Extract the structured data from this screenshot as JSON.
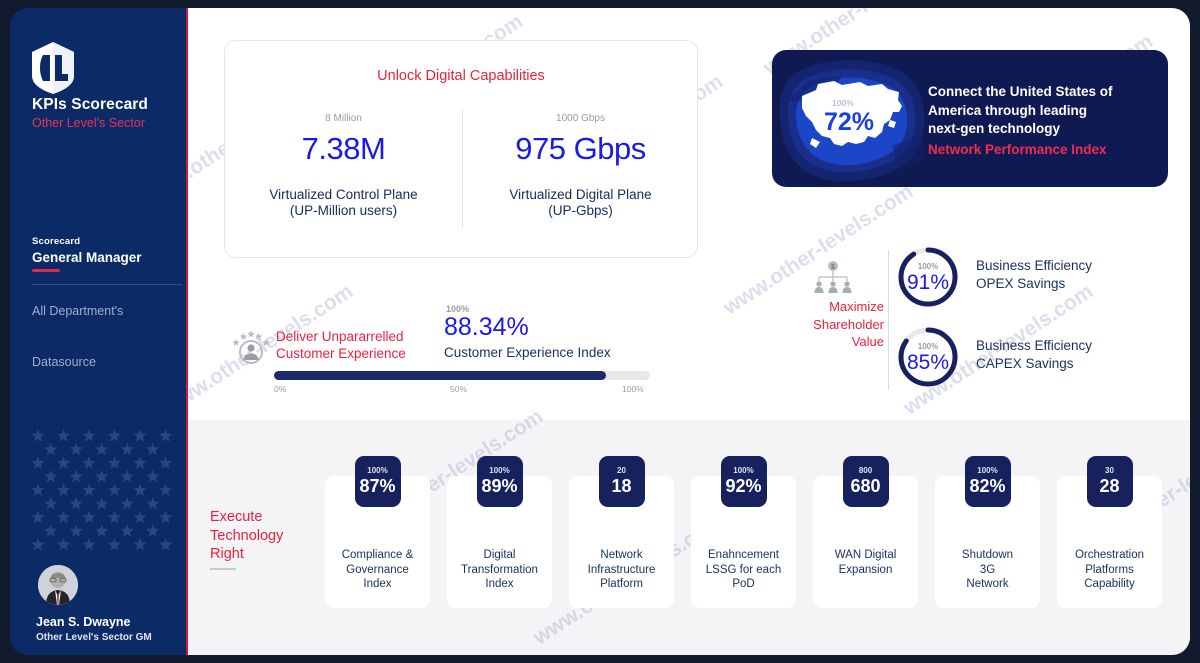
{
  "brand": {
    "logo_icon": "ol-shield-logo",
    "title": "KPIs Scorecard",
    "subtitle": "Other Level's Sector"
  },
  "sidebar": {
    "active": {
      "eyebrow": "Scorecard",
      "label": "General Manager"
    },
    "items": [
      {
        "label": "All Department's"
      },
      {
        "label": "Datasource"
      }
    ],
    "user": {
      "avatar_icon": "user-avatar",
      "name": "Jean S. Dwayne",
      "role": "Other Level's Sector GM"
    }
  },
  "watermark": {
    "text": "www.other-levels.com"
  },
  "digital_card": {
    "title": "Unlock Digital Capabilities",
    "metrics": [
      {
        "target": "8 Million",
        "value": "7.38M",
        "caption_line1": "Virtualized Control Plane",
        "caption_line2": "(UP-Million users)"
      },
      {
        "target": "1000 Gbps",
        "value": "975 Gbps",
        "caption_line1": "Virtualized Digital Plane",
        "caption_line2": "(UP-Gbps)"
      }
    ]
  },
  "map_card": {
    "map_icon": "usa-map",
    "target": "100%",
    "value": "72%",
    "line1": "Connect the United States of",
    "line2": "America through leading",
    "line3": "next-gen technology",
    "index_label": "Network Performance Index"
  },
  "shareholder": {
    "icon": "shareholder-value-icon",
    "label_line1": "Maximize",
    "label_line2": "Shareholder",
    "label_line3": "Value",
    "gauges": [
      {
        "target": "100%",
        "value": "91%",
        "percent": 91,
        "label_line1": "Business Efficiency",
        "label_line2": "OPEX Savings"
      },
      {
        "target": "100%",
        "value": "85%",
        "percent": 85,
        "label_line1": "Business Efficiency",
        "label_line2": "CAPEX Savings"
      }
    ]
  },
  "customer_experience": {
    "icon": "customer-rating-icon",
    "label_line1": "Deliver Unpararrelled",
    "label_line2": "Customer Experience",
    "target": "100%",
    "value": "88.34%",
    "caption": "Customer Experience Index",
    "percent": 88.34,
    "ticks": {
      "min": "0%",
      "mid": "50%",
      "max": "100%"
    }
  },
  "execute": {
    "label_line1": "Execute",
    "label_line2": "Technology",
    "label_line3": "Right",
    "cards": [
      {
        "target": "100%",
        "value": "87%",
        "l1": "Compliance &",
        "l2": "Governance",
        "l3": "Index"
      },
      {
        "target": "100%",
        "value": "89%",
        "l1": "Digital",
        "l2": "Transformation",
        "l3": "Index"
      },
      {
        "target": "20",
        "value": "18",
        "l1": "Network",
        "l2": "Infrastructure",
        "l3": "Platform"
      },
      {
        "target": "100%",
        "value": "92%",
        "l1": "Enahncement",
        "l2": "LSSG for each",
        "l3": "PoD"
      },
      {
        "target": "800",
        "value": "680",
        "l1": "WAN Digital",
        "l2": "Expansion",
        "l3": ""
      },
      {
        "target": "100%",
        "value": "82%",
        "l1": "Shutdown",
        "l2": "3G",
        "l3": "Network"
      },
      {
        "target": "30",
        "value": "28",
        "l1": "Orchestration",
        "l2": "Platforms",
        "l3": "Capability"
      }
    ]
  },
  "colors": {
    "navy": "#0b2a66",
    "deep_navy": "#16215e",
    "red": "#ef1f3c",
    "accent_blue": "#1a1ae8",
    "card_bg": "#ffffff",
    "gray_band": "#f4f4f6"
  }
}
